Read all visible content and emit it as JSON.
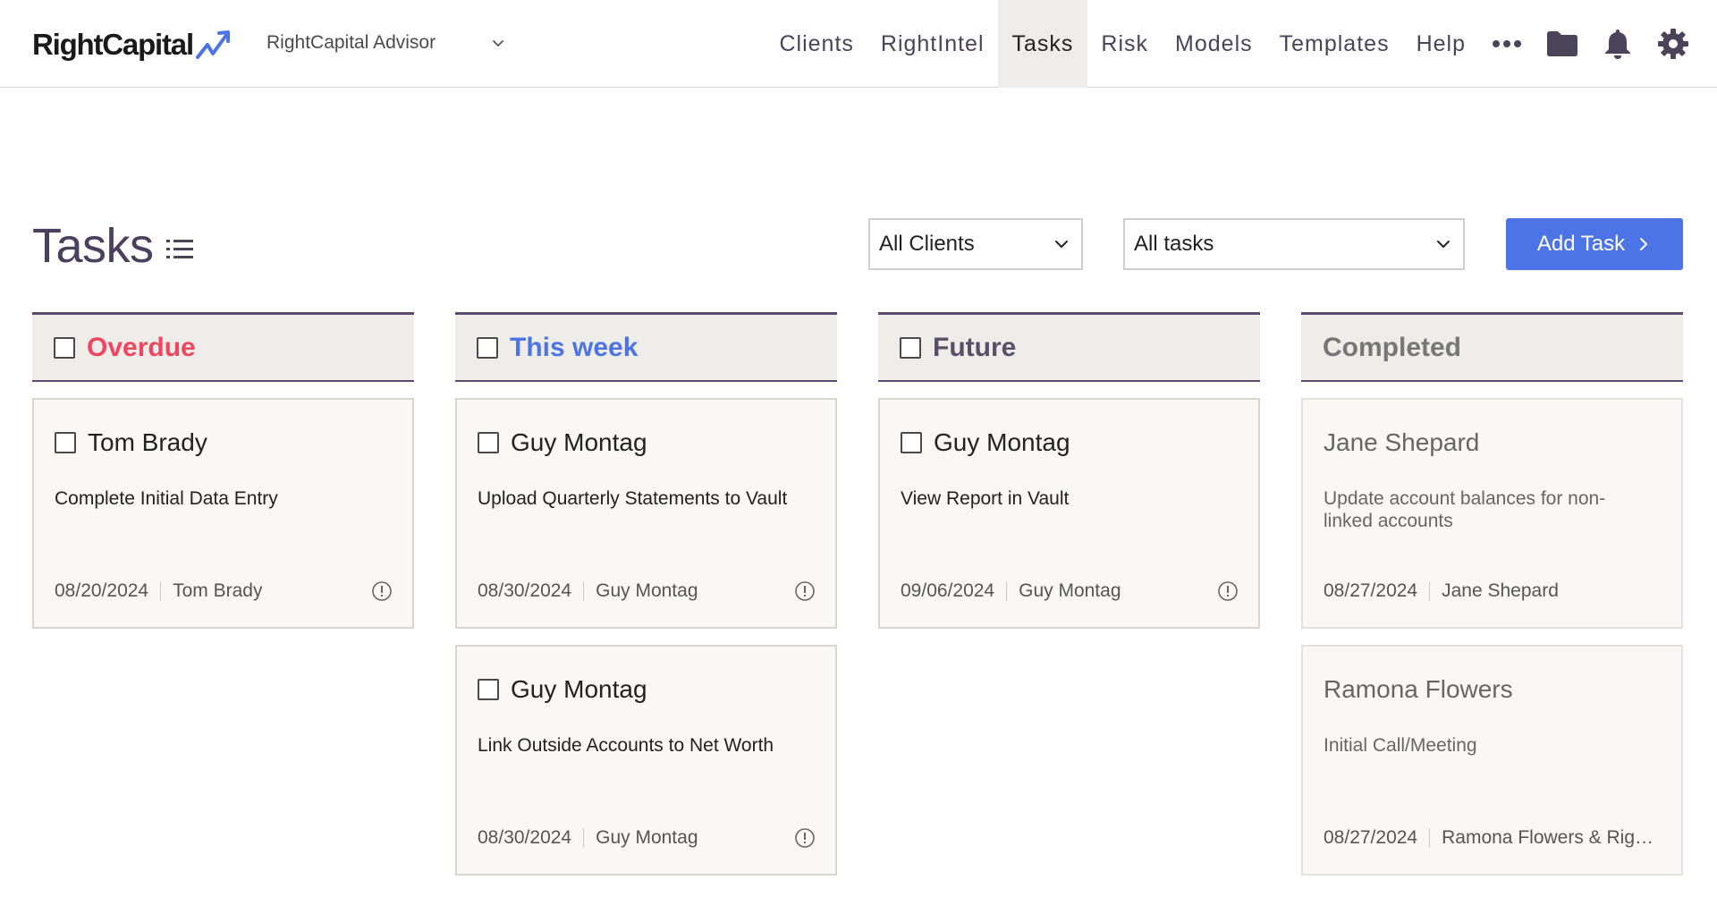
{
  "header": {
    "logo_text": "RightCapital",
    "account_name": "RightCapital Advisor",
    "nav": [
      {
        "label": "Clients"
      },
      {
        "label": "RightIntel"
      },
      {
        "label": "Tasks"
      },
      {
        "label": "Risk"
      },
      {
        "label": "Models"
      },
      {
        "label": "Templates"
      },
      {
        "label": "Help"
      }
    ],
    "active_nav": "Tasks"
  },
  "page": {
    "title": "Tasks",
    "client_filter": "All Clients",
    "task_filter": "All tasks",
    "add_button": "Add Task"
  },
  "colors": {
    "overdue": "#f0465e",
    "this_week": "#4d74e6",
    "future": "#5a4f68",
    "completed": "#777777",
    "accent": "#4d74e6"
  },
  "columns": [
    {
      "label": "Overdue",
      "cards": [
        {
          "name": "Tom Brady",
          "desc": "Complete Initial Data Entry",
          "date": "08/20/2024",
          "assignee": "Tom Brady"
        }
      ]
    },
    {
      "label": "This week",
      "cards": [
        {
          "name": "Guy Montag",
          "desc": "Upload Quarterly Statements to Vault",
          "date": "08/30/2024",
          "assignee": "Guy Montag"
        },
        {
          "name": "Guy Montag",
          "desc": "Link Outside Accounts to Net Worth",
          "date": "08/30/2024",
          "assignee": "Guy Montag"
        }
      ]
    },
    {
      "label": "Future",
      "cards": [
        {
          "name": "Guy Montag",
          "desc": "View Report in Vault",
          "date": "09/06/2024",
          "assignee": "Guy Montag"
        }
      ]
    },
    {
      "label": "Completed",
      "cards": [
        {
          "name": "Jane Shepard",
          "desc": "Update account balances for non-linked accounts",
          "date": "08/27/2024",
          "assignee": "Jane Shepard"
        },
        {
          "name": "Ramona Flowers",
          "desc": "Initial Call/Meeting",
          "date": "08/27/2024",
          "assignee": "Ramona Flowers & Righ..."
        }
      ]
    }
  ]
}
